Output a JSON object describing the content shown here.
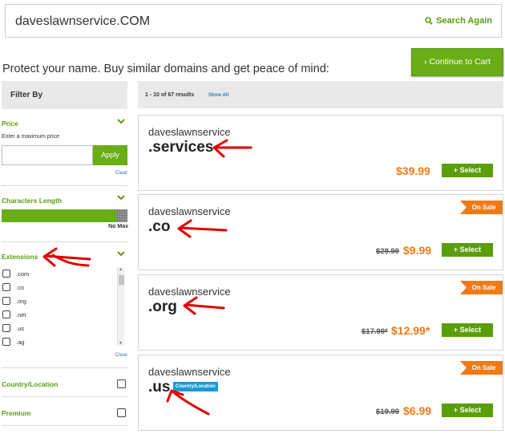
{
  "search": {
    "query": "daveslawnservice.COM",
    "again_label": "Search Again"
  },
  "headline": "Protect your name. Buy similar domains and get peace of mind:",
  "cart_button": "Continue to Cart",
  "filter": {
    "title": "Filter By",
    "price": {
      "title": "Price",
      "hint": "Enter a maximum price",
      "apply_label": "Apply",
      "clear_label": "Clear",
      "input_value": ""
    },
    "length": {
      "title": "Characters Length",
      "max_label": "No Max"
    },
    "extensions": {
      "title": "Extensions",
      "items": [
        ".com",
        ".co",
        ".org",
        ".net",
        ".us",
        ".ag"
      ],
      "clear_label": "Clear"
    },
    "country": {
      "title": "Country/Location"
    },
    "premium": {
      "title": "Premium"
    }
  },
  "results": {
    "count_text": "1 - 10 of 67 results",
    "show_all": "Show All"
  },
  "cards": [
    {
      "name": "daveslawnservice",
      "tld": ".services",
      "price": "$39.99",
      "old_price": "",
      "sale": "",
      "badge": "",
      "select": "+ Select"
    },
    {
      "name": "daveslawnservice",
      "tld": ".co",
      "price": "$9.99",
      "old_price": "$29.99",
      "sale": "On Sale",
      "badge": "",
      "select": "+ Select"
    },
    {
      "name": "daveslawnservice",
      "tld": ".org",
      "price": "$12.99*",
      "old_price": "$17.99*",
      "sale": "On Sale",
      "badge": "",
      "select": "+ Select"
    },
    {
      "name": "daveslawnservice",
      "tld": ".us",
      "price": "$6.99",
      "old_price": "$19.99",
      "sale": "On Sale",
      "badge": "Country/Location",
      "select": "+ Select"
    }
  ],
  "colors": {
    "accent_green": "#69ad17",
    "price_orange": "#f07a15",
    "link_blue": "#2a7fb5",
    "annotation_red": "#e00000"
  }
}
